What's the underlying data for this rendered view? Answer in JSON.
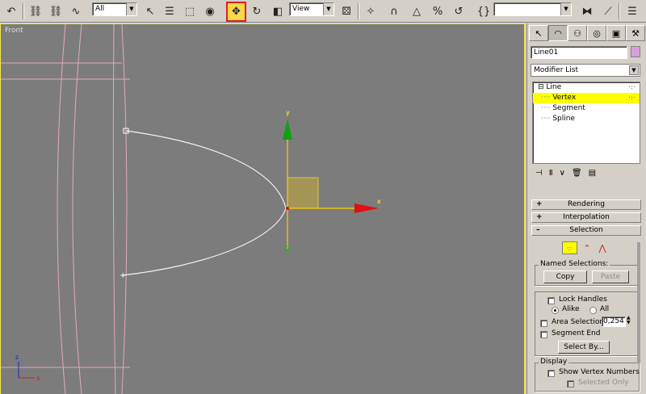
{
  "toolbar": {
    "selection_filter": "All",
    "ref_coord": "View",
    "named_sel": ""
  },
  "viewport": {
    "label": "Front",
    "gizmo": {
      "y_label": "y",
      "x_label": "x"
    },
    "axis_tripod": {
      "z_label": "z",
      "x_label": "x"
    }
  },
  "panel": {
    "object_name": "Line01",
    "object_color": "#d6a0e0",
    "modifier_list": "Modifier List",
    "stack": [
      {
        "label": "Line",
        "prefix": "⊟",
        "selected": false
      },
      {
        "label": "Vertex",
        "prefix": "····",
        "selected": true
      },
      {
        "label": "Segment",
        "prefix": "····",
        "selected": false
      },
      {
        "label": "Spline",
        "prefix": "····",
        "selected": false
      }
    ],
    "rollouts": {
      "rendering": "Rendering",
      "interpolation": "Interpolation",
      "selection": "Selection"
    },
    "selection": {
      "named_selections": "Named Selections:",
      "copy": "Copy",
      "paste": "Paste",
      "lock_handles": "Lock Handles",
      "alike": "Alike",
      "all": "All",
      "area_selection": "Area Selection:",
      "area_value": "0,254",
      "segment_end": "Segment End",
      "select_by": "Select By...",
      "display": "Display",
      "show_vertex_numbers": "Show Vertex Numbers",
      "selected_only": "Selected Only"
    }
  }
}
